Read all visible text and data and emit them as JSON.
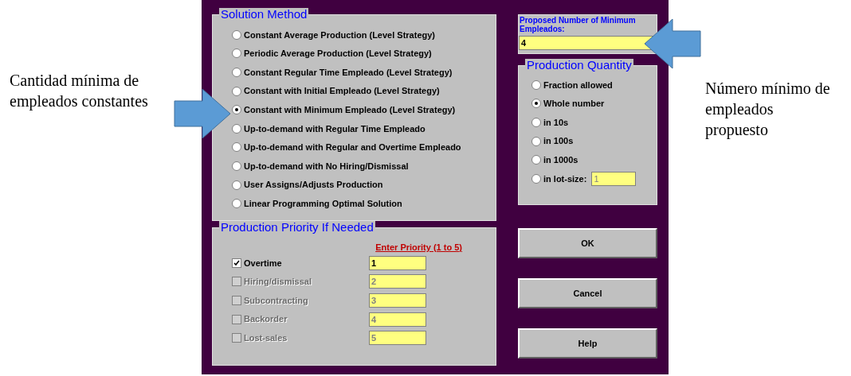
{
  "annotations": {
    "left_note": "Cantidad mínima de empleados constantes",
    "right_note": "Número mínimo de empleados propuesto"
  },
  "solution_method": {
    "title": "Solution Method",
    "options": [
      {
        "label": "Constant Average Production (Level Strategy)",
        "selected": false
      },
      {
        "label": "Periodic Average Production (Level Strategy)",
        "selected": false
      },
      {
        "label": "Constant Regular Time Empleado (Level Strategy)",
        "selected": false
      },
      {
        "label": "Constant with Initial Empleado (Level Strategy)",
        "selected": false
      },
      {
        "label": "Constant with Minimum Empleado (Level Strategy)",
        "selected": true
      },
      {
        "label": "Up-to-demand with Regular Time Empleado",
        "selected": false
      },
      {
        "label": "Up-to-demand with Regular and Overtime Empleado",
        "selected": false
      },
      {
        "label": "Up-to-demand with No Hiring/Dismissal",
        "selected": false
      },
      {
        "label": "User Assigns/Adjusts Production",
        "selected": false
      },
      {
        "label": "Linear Programming Optimal Solution",
        "selected": false
      }
    ]
  },
  "production_priority": {
    "title": "Production Priority If Needed",
    "column_header": "Enter Priority (1 to 5)",
    "items": [
      {
        "label": "Overtime",
        "checked": true,
        "disabled": false,
        "priority": "1"
      },
      {
        "label": "Hiring/dismissal",
        "checked": false,
        "disabled": true,
        "priority": "2"
      },
      {
        "label": "Subcontracting",
        "checked": false,
        "disabled": true,
        "priority": "3"
      },
      {
        "label": "Backorder",
        "checked": false,
        "disabled": true,
        "priority": "4"
      },
      {
        "label": "Lost-sales",
        "checked": false,
        "disabled": true,
        "priority": "5"
      }
    ]
  },
  "minimum_empleados": {
    "label": "Proposed Number of Minimum Empleados:",
    "value": "4"
  },
  "production_quantity": {
    "title": "Production Quantity",
    "options": [
      {
        "label": "Fraction allowed",
        "selected": false
      },
      {
        "label": "Whole number",
        "selected": true
      },
      {
        "label": "in 10s",
        "selected": false
      },
      {
        "label": "in 100s",
        "selected": false
      },
      {
        "label": "in 1000s",
        "selected": false
      },
      {
        "label": "in lot-size:",
        "selected": false,
        "value": "1"
      }
    ]
  },
  "buttons": [
    "OK",
    "Cancel",
    "Help"
  ]
}
